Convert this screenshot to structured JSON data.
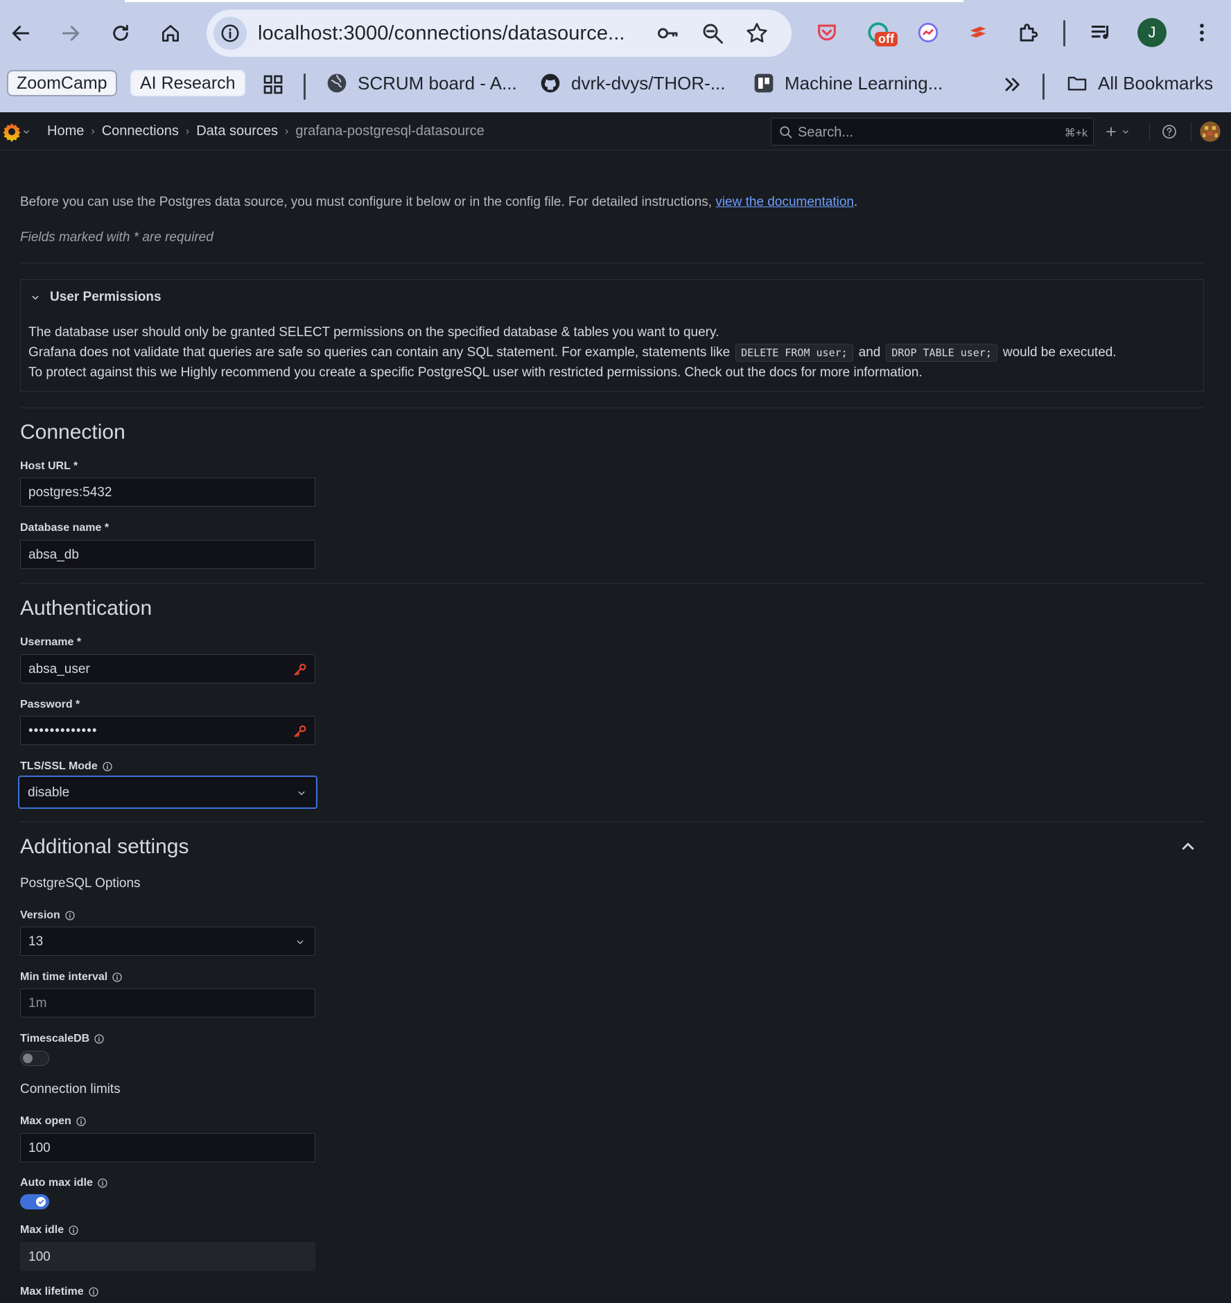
{
  "browser": {
    "url": "localhost:3000/connections/datasource...",
    "profile_initial": "J",
    "extension_badge": "off",
    "bookmarks": [
      {
        "label": "ZoomCamp",
        "style": "chip"
      },
      {
        "label": "AI Research",
        "style": "chip"
      },
      {
        "label": "SCRUM board - A...",
        "icon": "globe-icon"
      },
      {
        "label": "dvrk-dvys/THOR-...",
        "icon": "github-icon"
      },
      {
        "label": "Machine Learning...",
        "icon": "trello-icon"
      }
    ],
    "all_bookmarks": "All Bookmarks"
  },
  "grafana": {
    "breadcrumbs": [
      "Home",
      "Connections",
      "Data sources",
      "grafana-postgresql-datasource"
    ],
    "search": {
      "placeholder": "Search...",
      "shortcut": "⌘+k"
    }
  },
  "page": {
    "intro_text": "Before you can use the Postgres data source, you must configure it below or in the config file. For detailed instructions, ",
    "intro_link": "view the documentation",
    "intro_end": ".",
    "required_note": "Fields marked with * are required",
    "permissions": {
      "title": "User Permissions",
      "line1": "The database user should only be granted SELECT permissions on the specified database & tables you want to query.",
      "line2_a": "Grafana does not validate that queries are safe so queries can contain any SQL statement. For example, statements like",
      "code1": "DELETE FROM user;",
      "line2_b": "and",
      "code2": "DROP TABLE user;",
      "line2_c": "would be executed.",
      "line3": "To protect against this we Highly recommend you create a specific PostgreSQL user with restricted permissions. Check out the docs for more information."
    },
    "connection": {
      "heading": "Connection",
      "host_label": "Host URL *",
      "host_value": "postgres:5432",
      "db_label": "Database name *",
      "db_value": "absa_db"
    },
    "authentication": {
      "heading": "Authentication",
      "username_label": "Username *",
      "username_value": "absa_user",
      "password_label": "Password *",
      "password_value": "•••••••••••••",
      "tls_label": "TLS/SSL Mode",
      "tls_value": "disable"
    },
    "additional": {
      "heading": "Additional settings",
      "pg_options": "PostgreSQL Options",
      "version_label": "Version",
      "version_value": "13",
      "min_interval_label": "Min time interval",
      "min_interval_placeholder": "1m",
      "timescale_label": "TimescaleDB",
      "timescale_on": false,
      "conn_limits": "Connection limits",
      "max_open_label": "Max open",
      "max_open_value": "100",
      "auto_max_idle_label": "Auto max idle",
      "auto_max_idle_on": true,
      "max_idle_label": "Max idle",
      "max_idle_value": "100",
      "max_lifetime_label": "Max lifetime"
    }
  },
  "colors": {
    "background": "#181b1f",
    "accent": "#3d71d9",
    "link": "#6e9fff",
    "key_icon": "#e0452b"
  }
}
